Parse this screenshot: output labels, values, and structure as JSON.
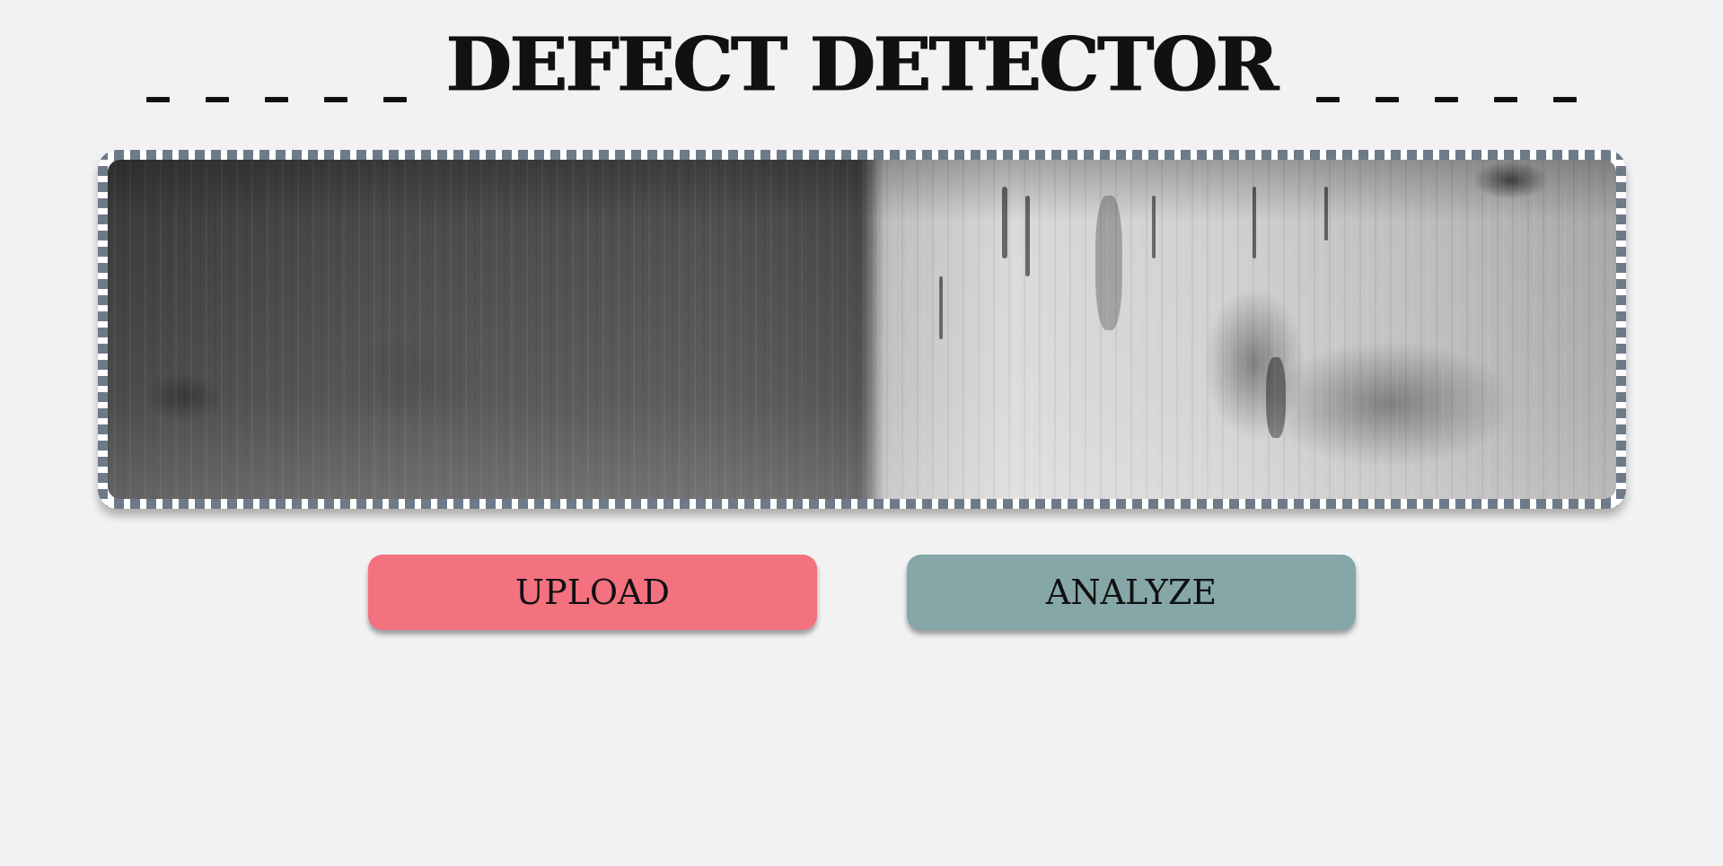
{
  "header": {
    "title": "DEFECT DETECTOR"
  },
  "image_panel": {
    "image_description": "grayscale steel surface",
    "frame_color": "#6e7a8a"
  },
  "actions": {
    "upload_label": "UPLOAD",
    "upload_color": "#f4717f",
    "analyze_label": "ANALYZE",
    "analyze_color": "#85a7a8"
  },
  "page": {
    "background": "#f2f2f2"
  }
}
